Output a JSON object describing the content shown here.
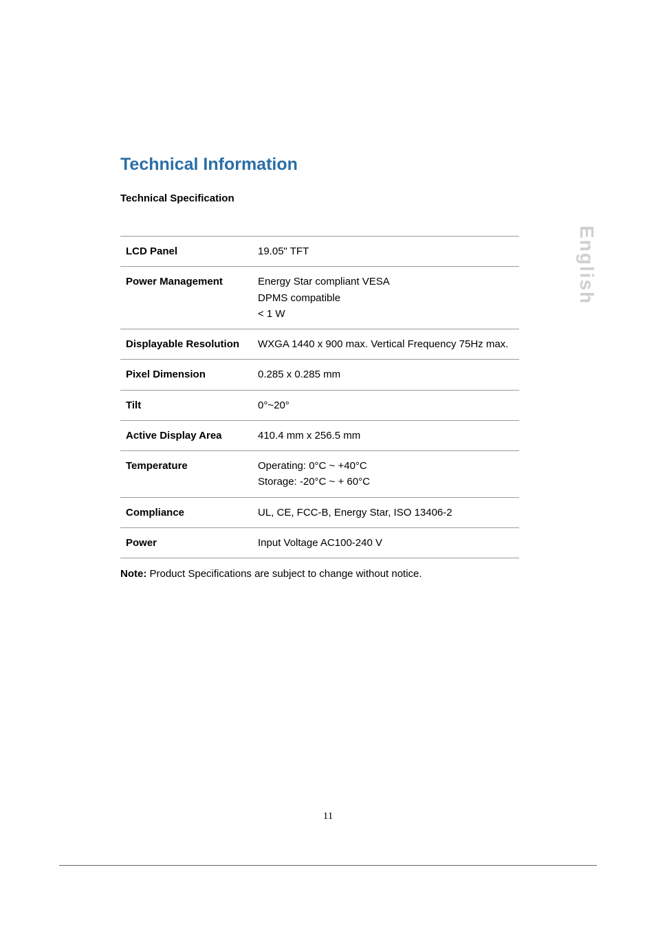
{
  "title": "Technical Information",
  "subtitle": "Technical Specification",
  "side_tab": "English",
  "page_number": "11",
  "note_label": "Note:",
  "note_text": " Product Specifications are subject to change without notice.",
  "specs": [
    {
      "label": "LCD Panel",
      "value": "19.05\" TFT"
    },
    {
      "label": "Power Management",
      "value": "Energy Star compliant VESA\nDPMS compatible\n< 1 W"
    },
    {
      "label": "Displayable Resolution",
      "value": "WXGA 1440 x 900 max. Vertical Frequency 75Hz max."
    },
    {
      "label": "Pixel Dimension",
      "value": "0.285 x 0.285 mm"
    },
    {
      "label": "Tilt",
      "value": "0°~20°"
    },
    {
      "label": "Active Display Area",
      "value": "410.4 mm x 256.5 mm"
    },
    {
      "label": "Temperature",
      "value": "Operating: 0°C ~ +40°C\nStorage: -20°C ~ + 60°C"
    },
    {
      "label": "Compliance",
      "value": "UL, CE, FCC-B, Energy Star, ISO 13406-2"
    },
    {
      "label": "Power",
      "value": "Input Voltage   AC100-240 V"
    }
  ]
}
